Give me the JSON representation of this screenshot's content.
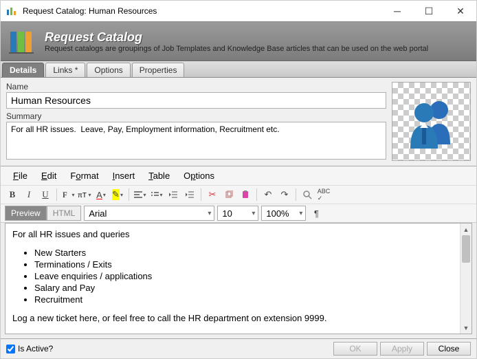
{
  "window": {
    "title": "Request Catalog: Human Resources"
  },
  "header": {
    "title": "Request Catalog",
    "desc": "Request catalogs are groupings of Job Templates and Knowledge Base articles that can be used on the web portal"
  },
  "tabs": [
    "Details",
    "Links *",
    "Options",
    "Properties"
  ],
  "form": {
    "nameLabel": "Name",
    "nameValue": "Human Resources",
    "summaryLabel": "Summary",
    "summaryValue": "For all HR issues.  Leave, Pay, Employment information, Recruitment etc."
  },
  "editorMenu": {
    "file": "File",
    "edit": "Edit",
    "format": "Format",
    "insert": "Insert",
    "table": "Table",
    "options": "Options"
  },
  "viewToggle": {
    "preview": "Preview",
    "html": "HTML"
  },
  "fontControls": {
    "font": "Arial",
    "size": "10",
    "zoom": "100%"
  },
  "content": {
    "intro": "For all HR issues and queries",
    "items": [
      "New Starters",
      "Terminations / Exits",
      "Leave enquiries / applications",
      "Salary and Pay",
      "Recruitment"
    ],
    "outro": "Log a new ticket here, or feel free to call the HR department on extension 9999."
  },
  "footer": {
    "activeLabel": "Is Active?",
    "ok": "OK",
    "apply": "Apply",
    "close": "Close"
  }
}
